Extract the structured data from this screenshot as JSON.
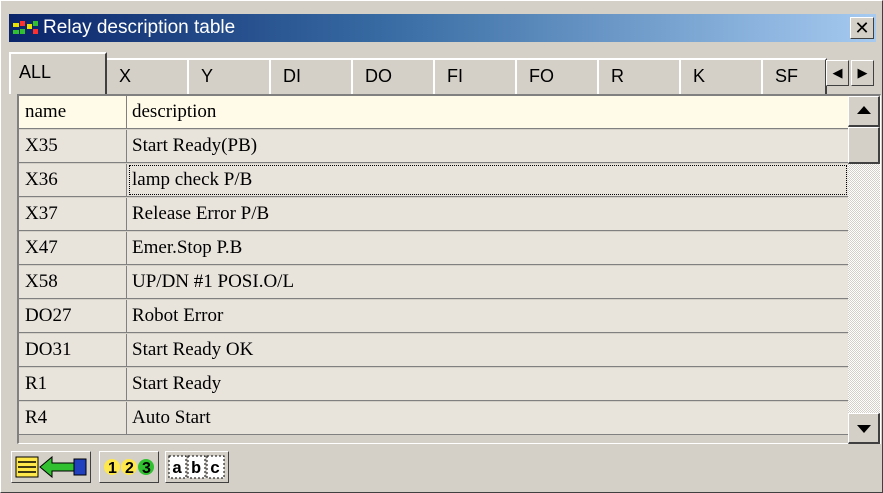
{
  "window": {
    "title": "Relay description table",
    "close_label": "✕"
  },
  "tabs": [
    "ALL",
    "X",
    "Y",
    "DI",
    "DO",
    "FI",
    "FO",
    "R",
    "K",
    "SF"
  ],
  "tab_scroll": {
    "left": "◀",
    "right": "▶"
  },
  "table": {
    "columns": {
      "name": "name",
      "description": "description"
    },
    "rows": [
      {
        "name": "X35",
        "description": "Start Ready(PB)"
      },
      {
        "name": "X36",
        "description": "lamp check P/B"
      },
      {
        "name": "X37",
        "description": "Release Error P/B"
      },
      {
        "name": "X47",
        "description": "Emer.Stop P.B"
      },
      {
        "name": "X58",
        "description": "UP/DN #1 POSI.O/L"
      },
      {
        "name": "DO27",
        "description": "Robot Error"
      },
      {
        "name": "DO31",
        "description": "Start Ready OK"
      },
      {
        "name": "R1",
        "description": "Start Ready"
      },
      {
        "name": "R4",
        "description": "Auto Start"
      }
    ],
    "selected_row": 1
  },
  "toolbar": {
    "buttons": [
      {
        "icon": "import-arrow-icon"
      },
      {
        "icon": "numbered-sort-icon",
        "text": "123"
      },
      {
        "icon": "alpha-sort-icon",
        "text": "abc"
      }
    ]
  },
  "colors": {
    "title_start": "#0a246a",
    "title_end": "#a6caf0",
    "face": "#d4d0c8",
    "header_bg": "#fffbe8",
    "row_bg": "#e8e4dc"
  }
}
